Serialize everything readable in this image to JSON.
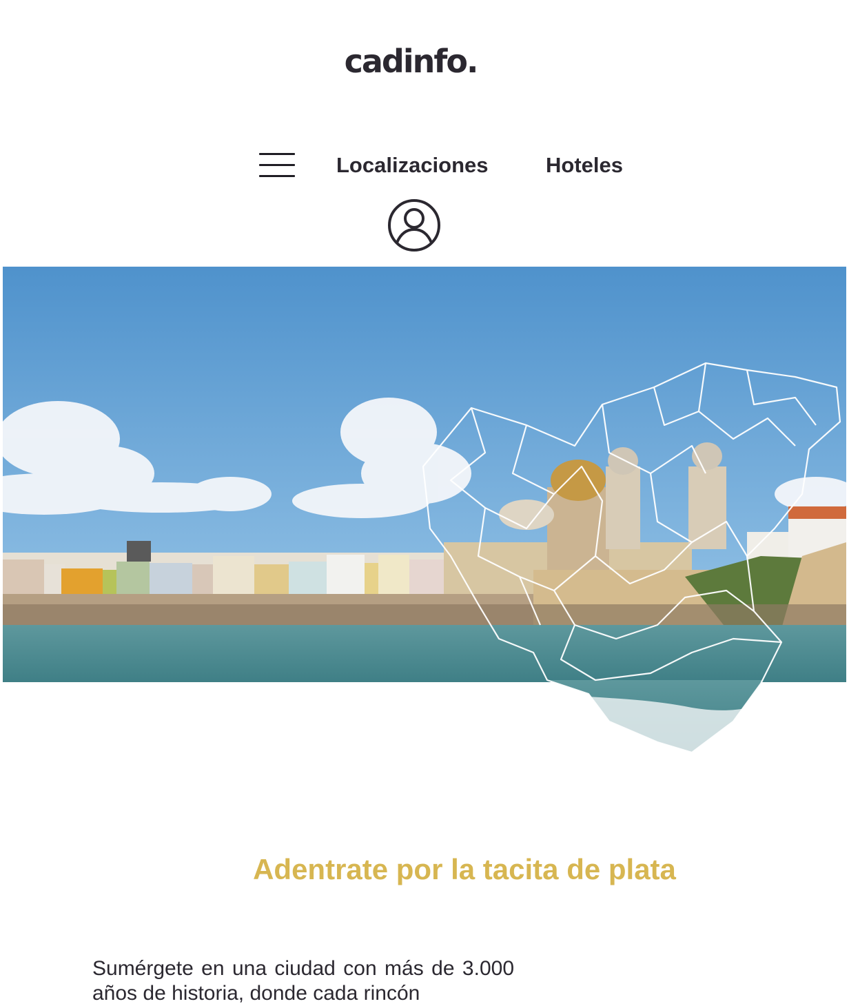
{
  "header": {
    "logo_text": "cadinfo."
  },
  "nav": {
    "menu_icon": "hamburger-menu-icon",
    "links": [
      {
        "label": "Localizaciones"
      },
      {
        "label": "Hoteles"
      }
    ],
    "account_icon": "user-account-icon"
  },
  "hero": {
    "image_subject": "Cádiz seafront with cathedral and province map outline"
  },
  "main": {
    "headline": "Adentrate por la tacita de plata",
    "intro": "Sumérgete en una ciudad con más de 3.000 años de historia, donde cada rincón"
  },
  "colors": {
    "accent": "#d7b651",
    "text": "#2b2830",
    "sky": "#5a9bd0",
    "sea": "#4f8f93"
  }
}
